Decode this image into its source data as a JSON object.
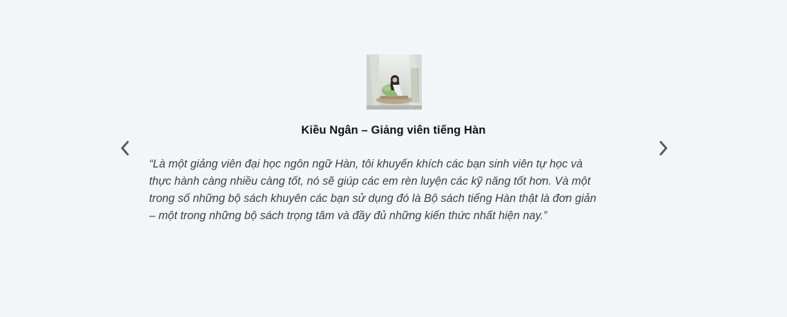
{
  "testimonial": {
    "author": "Kiều Ngân – Giảng viên tiếng Hàn",
    "quote_lines": [
      "“Là một giảng viên đại học ngôn ngữ Hàn, tôi khuyến khích các bạn sinh viên tự học và",
      "thực hành càng nhiều càng tốt, nó sẽ giúp các em rèn luyện các kỹ năng tốt hơn. Và một",
      "trong số những bộ sách khuyên các bạn sử dụng đó là Bộ sách tiếng Hàn thật là đơn giản",
      "– một trong những bộ sách trọng tâm và đầy đủ những kiến thức nhất hiện nay.”"
    ],
    "avatar_icon": "person-photo"
  },
  "controls": {
    "prev_icon": "chevron-left-icon",
    "next_icon": "chevron-right-icon"
  },
  "colors": {
    "background": "#f3f6f9",
    "name_text": "#111111",
    "quote_text": "#3f3f3f",
    "arrow": "#555a60"
  }
}
